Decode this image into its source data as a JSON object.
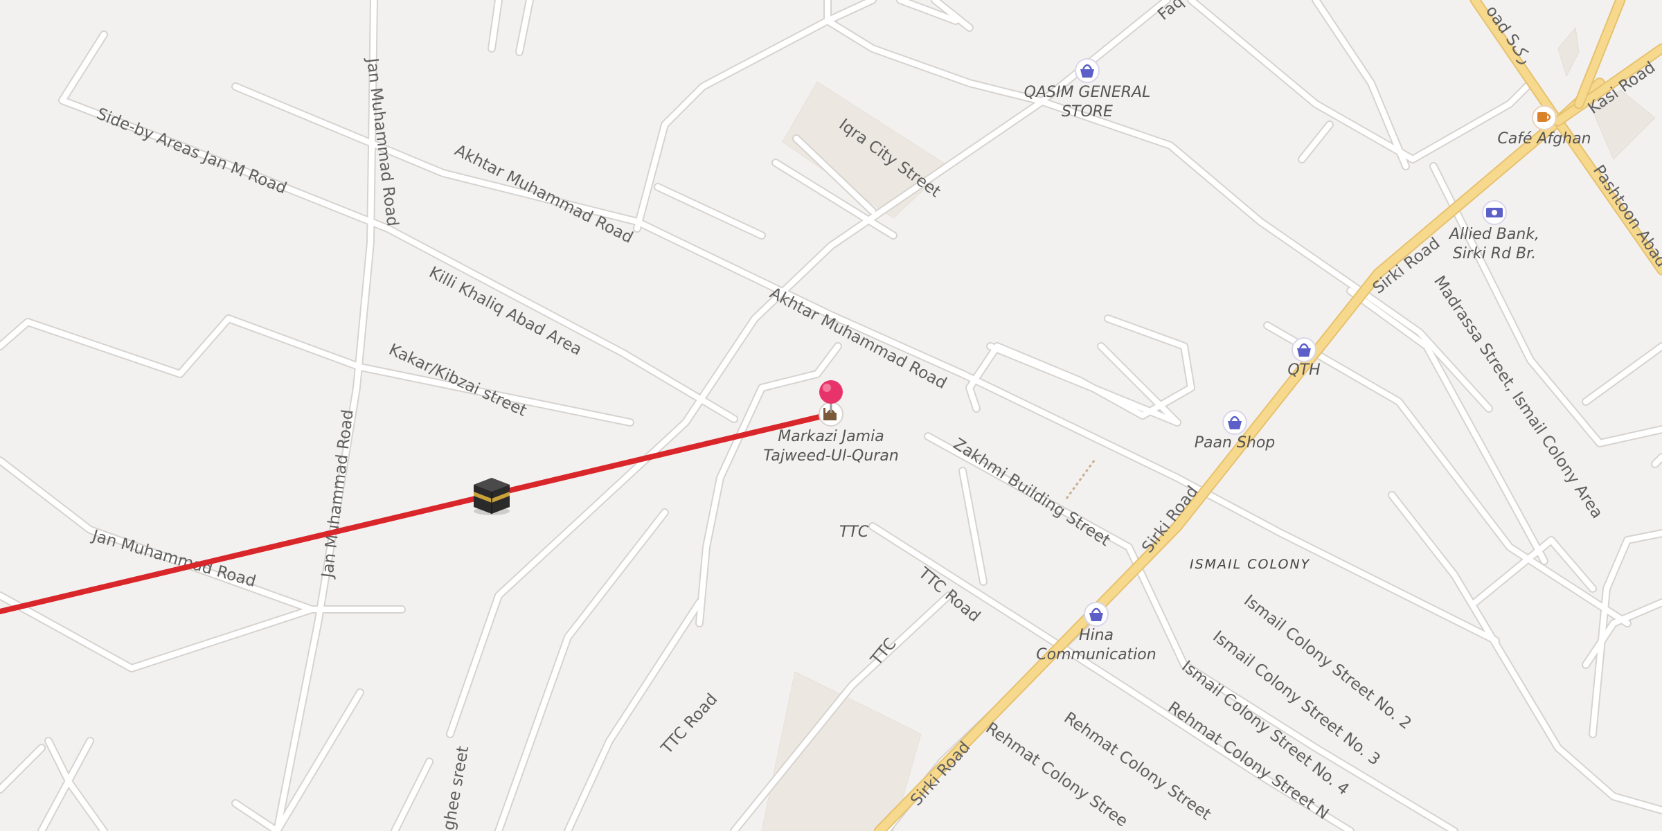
{
  "colors": {
    "background": "#f3f1ef",
    "minor_road": "#ffffff",
    "main_road": "#f6d98c",
    "route_line": "#d9262a",
    "pin": "#e8336a",
    "poi_shop": "#5b5fc7",
    "poi_cafe": "#d9822b"
  },
  "streets": {
    "side_by_areas": "Side-by Areas Jan M Road",
    "jan_muhammad_top": "Jan Muhammad Road",
    "jan_muhammad_mid": "Jan Muhammad Road",
    "jan_muhammad_low": "Jan Muhammad Road",
    "akhtar_1": "Akhtar Muhammad Road",
    "akhtar_2": "Akhtar Muhammad Road",
    "killi_khaliq": "Killi Khaliq Abad Area",
    "kakar": "Kakar/Kibzai street",
    "iqra": "Iqra City Street",
    "faq": "Faq",
    "sirki_1": "Sirki Road",
    "sirki_2": "Sirki Road",
    "sirki_3": "Sirki Road",
    "kasi": "Kasi Road",
    "pashtoon": "Pashtoon Abad R",
    "urdu_road": "oad Sرک",
    "madrassa": "Madrassa Street, Ismail Colony Area",
    "zakhmi": "Zakhmi Building Street",
    "ttc": "TTC",
    "ttc_road_1": "TTC Road",
    "ttc_road_2": "TTC Road",
    "ttc_2": "TTC",
    "ismail_2": "Ismail Colony Street No. 2",
    "ismail_3": "Ismail Colony Street No. 3",
    "ismail_4": "Ismail Colony Street No. 4",
    "rehmat_1": "Rehmat Colony Stree",
    "rehmat_2": "Rehmat Colony Street",
    "rehmat_3": "Rehmat Colony Street N",
    "ghee": "ghee sreet"
  },
  "areas": {
    "ismail_colony": "ISMAIL COLONY"
  },
  "pois": [
    {
      "name": "QASIM GENERAL",
      "name2": "STORE",
      "icon": "shopping-basket-icon"
    },
    {
      "name": "Café Afghan",
      "icon": "coffee-cup-icon"
    },
    {
      "name": "Allied Bank,",
      "name2": "Sirki Rd Br.",
      "icon": "bank-note-icon"
    },
    {
      "name": "QTH",
      "icon": "shopping-basket-icon"
    },
    {
      "name": "Paan Shop",
      "icon": "shopping-basket-icon"
    },
    {
      "name": "Hina",
      "name2": "Communication",
      "icon": "shopping-basket-icon"
    },
    {
      "name": "Markazi Jamia",
      "name2": "Tajweed-Ul-Quran",
      "icon": "mosque-icon"
    }
  ],
  "markers": {
    "destination_pin": "map-pin-icon",
    "qibla_marker": "kaaba-icon"
  }
}
